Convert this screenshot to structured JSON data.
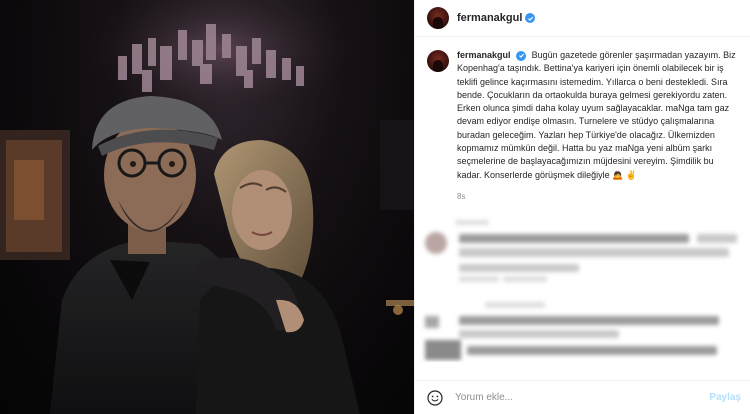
{
  "post": {
    "username": "fermanakgul",
    "caption": "Bugün gazetede görenler şaşırmadan yazayım. Biz Kopenhag'a taşındık. Bettina'ya kariyeri için önemli olabilecek bir iş teklifi gelince kaçırmasını istemedim. Yıllarca o beni destekledi. Sıra bende. Çocukların da ortaokulda buraya gelmesi gerekiyordu zaten. Erken olunca şimdi daha kolay uyum sağlayacaklar. maNga tam gaz devam ediyor endişe olmasın. Turnelere ve stüdyo çalışmalarına buradan geleceğim. Yazları hep Türkiye'de olacağız. Ülkemizden kopmamız mümkün değil. Hatta bu yaz maNga yeni albüm şarkı seçmelerine de başlayacağımızın müjdesini vereyim. Şimdilik bu kadar. Konserlerde görüşmek dileğiyle 🙇 ✌️",
    "time": "8s"
  },
  "comment_box": {
    "placeholder": "Yorum ekle...",
    "post_label": "Paylaş"
  },
  "icons": {
    "verified": "verified-badge-icon",
    "emoji": "smiley-icon"
  },
  "colors": {
    "verified": "#3897f0",
    "post_button": "#b2dffc"
  }
}
